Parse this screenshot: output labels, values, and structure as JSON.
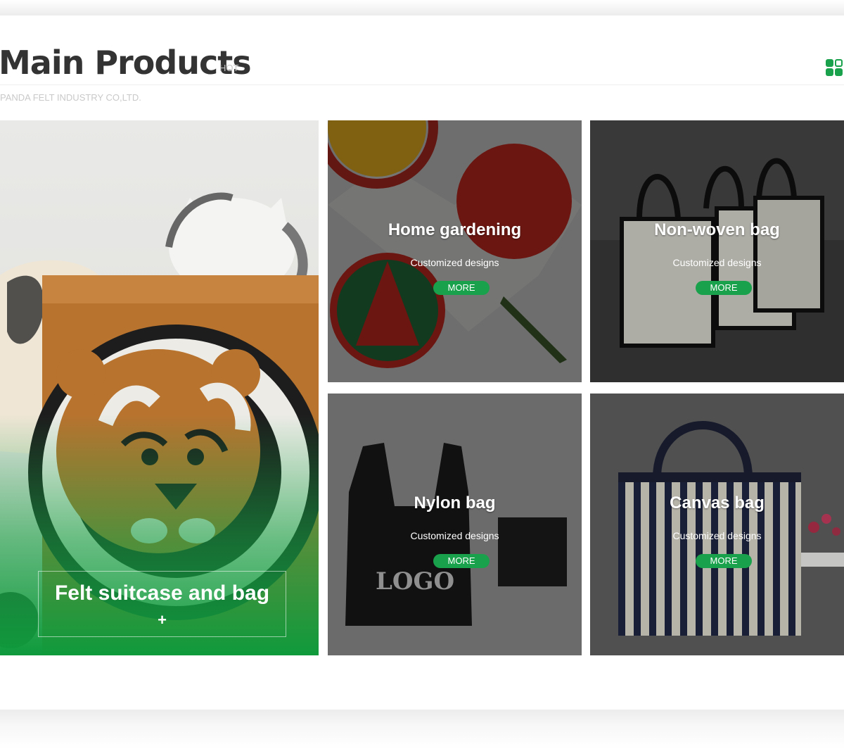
{
  "section": {
    "title": "Main Products",
    "tag": "HOT",
    "subtitle": "PANDA FELT INDUSTRY CO,LTD.",
    "icon": "grid-icon"
  },
  "featured": {
    "title": "Felt suitcase and bag",
    "plus": "+"
  },
  "cards": [
    {
      "title": "Home gardening",
      "subtitle": "Customized designs",
      "button": "MORE"
    },
    {
      "title": "Non-woven bag",
      "subtitle": "Customized designs",
      "button": "MORE"
    },
    {
      "title": "Nylon bag",
      "subtitle": "Customized designs",
      "button": "MORE",
      "print": "LOGO"
    },
    {
      "title": "Canvas bag",
      "subtitle": "Customized designs",
      "button": "MORE"
    }
  ],
  "colors": {
    "accent": "#1aa14b",
    "title": "#333333"
  }
}
